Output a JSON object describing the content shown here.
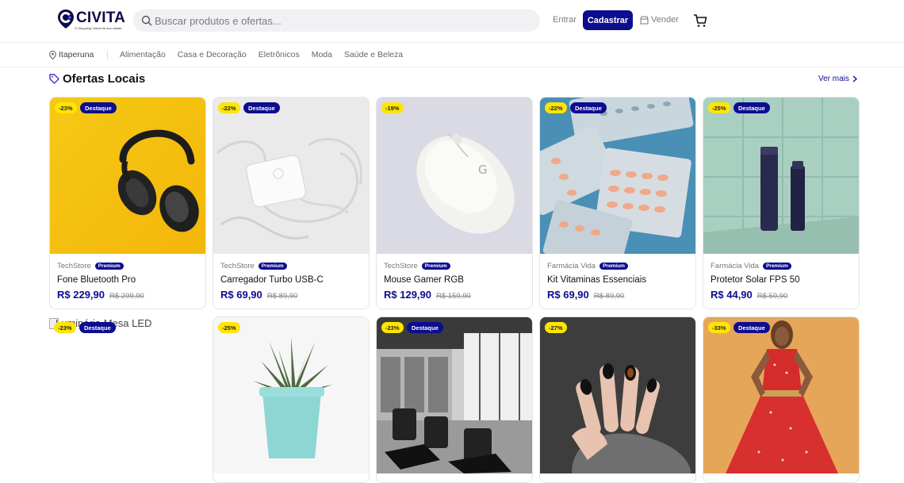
{
  "header": {
    "logo_text": "CIVITA",
    "logo_tagline": "O Shopping Virtual de sua cidade",
    "search_placeholder": "Buscar produtos e ofertas...",
    "login_label": "Entrar",
    "signup_label": "Cadastrar",
    "sell_label": "Vender"
  },
  "nav": {
    "location": "Itaperuna",
    "categories": [
      "Alimentação",
      "Casa e Decoração",
      "Eletrônicos",
      "Moda",
      "Saúde e Beleza"
    ]
  },
  "section": {
    "title": "Ofertas Locais",
    "see_more": "Ver mais"
  },
  "badge_featured": "Destaque",
  "badge_premium": "Premium",
  "products_row1": [
    {
      "discount": "-23%",
      "featured": true,
      "store": "TechStore",
      "name": "Fone Bluetooth Pro",
      "price": "R$ 229,90",
      "old_price": "R$ 299,90"
    },
    {
      "discount": "-22%",
      "featured": true,
      "store": "TechStore",
      "name": "Carregador Turbo USB-C",
      "price": "R$ 69,90",
      "old_price": "R$ 89,90"
    },
    {
      "discount": "-19%",
      "featured": false,
      "store": "TechStore",
      "name": "Mouse Gamer RGB",
      "price": "R$ 129,90",
      "old_price": "R$ 159,90"
    },
    {
      "discount": "-22%",
      "featured": true,
      "store": "Farmácia Vida",
      "name": "Kit Vitaminas Essenciais",
      "price": "R$ 69,90",
      "old_price": "R$ 89,90"
    },
    {
      "discount": "-25%",
      "featured": true,
      "store": "Farmácia Vida",
      "name": "Protetor Solar FPS 50",
      "price": "R$ 44,90",
      "old_price": "R$ 59,90"
    }
  ],
  "products_row2": [
    {
      "discount": "-23%",
      "featured": true,
      "alt_text": "Luminária Mesa LED"
    },
    {
      "discount": "-25%",
      "featured": false
    },
    {
      "discount": "-23%",
      "featured": true
    },
    {
      "discount": "-27%",
      "featured": false
    },
    {
      "discount": "-33%",
      "featured": true
    }
  ],
  "colors": {
    "brand": "#0d0d8f",
    "discount_badge": "#ffe500",
    "price": "#0d0d8f"
  }
}
